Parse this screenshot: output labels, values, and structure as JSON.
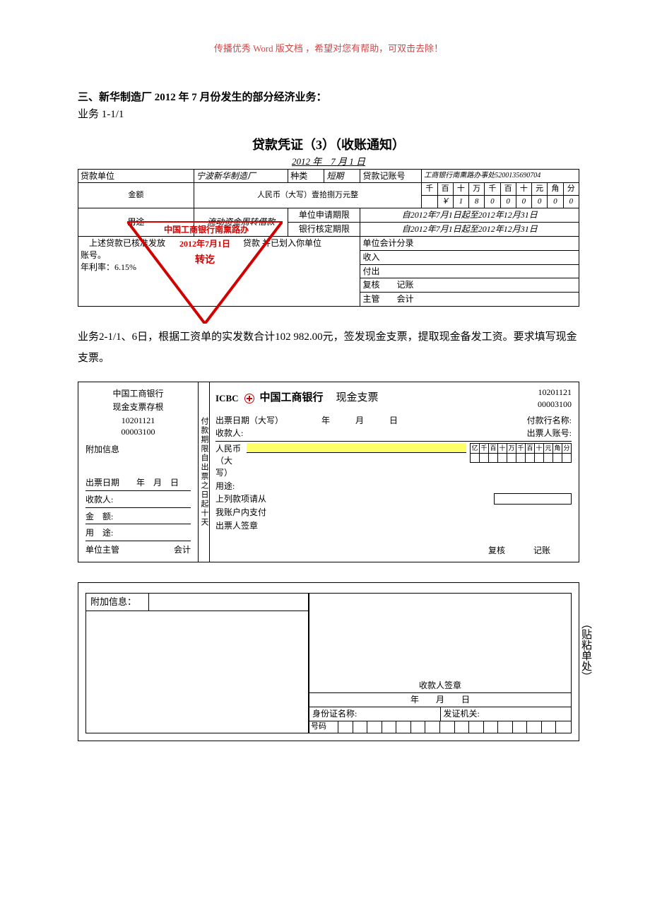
{
  "header_note": "传播优秀 Word 版文档 ，希望对您有帮助，可双击去除！",
  "section_heading": "三、新华制造厂 2012 年 7 月份发生的部分经济业务：",
  "biz_label": "业务 1-1/1",
  "voucher": {
    "title": "贷款凭证（3）（收账通知）",
    "date_line": "2012 年　7 月 1 日",
    "row1": {
      "unit_label": "贷款单位",
      "unit_value": "宁波新华制造厂",
      "type_label": "种类",
      "type_value": "短期",
      "acct_label": "贷款记账号",
      "acct_value": "工商银行南熏路办事处5200135690704"
    },
    "amount": {
      "label": "金额",
      "cn_label": "人民币（大写）壹拾捌万元整",
      "units": [
        "千",
        "百",
        "十",
        "万",
        "千",
        "百",
        "十",
        "元",
        "角",
        "分"
      ],
      "digits": [
        "",
        "￥",
        "1",
        "8",
        "0",
        "0",
        "0",
        "0",
        "0",
        "0"
      ]
    },
    "usage": {
      "label": "用途",
      "usage_text": "流动资金周转借款",
      "apply_label": "单位申请期限",
      "apply_value": "自2012年7月1日起至2012年12月31日",
      "bank_label": "银行核定期限",
      "bank_value": "自2012年7月1日起至2012年12月31日"
    },
    "bottom": {
      "l1": "　上述贷款已核准发放",
      "l2": "账号。",
      "l3": "年利率：6.15%",
      "mid": "贷款 并已划入你单位",
      "entries_label": "单位会计分录",
      "r_rows": [
        "收入",
        "付出",
        "复核　　记账",
        "主管　　会计"
      ]
    },
    "stamp": {
      "bank": "中国工商银行南熏路办",
      "date": "2012年7月1日",
      "type": "转讫"
    }
  },
  "para_biz2": "业务2-1/1、6日，根据工资单的实发数合计102 982.00元，签发现金支票，提取现金备发工资。要求填写现金支票。",
  "cheque": {
    "stub": {
      "bank": "中国工商银行",
      "title": "现金支票存根",
      "num1": "10201121",
      "num2": "00003100",
      "attach": "附加信息",
      "issue": "出票日期　　年　月　日",
      "payee": "收款人:",
      "amount": "金　额:",
      "purpose": "用　途:",
      "mgr": "单位主管",
      "acct": "会计"
    },
    "vlabel": "付款期限自出票之日起十天",
    "main": {
      "icbc": "ICBC",
      "bank_cn": "中国工商银行",
      "cheque_type": "现金支票",
      "num1": "10201121",
      "num2": "00003100",
      "issue_date": "出票日期（大写）　　　　　年　　　月　　　日",
      "payer_bank": "付款行名称:",
      "payee": "收款人:",
      "drawer_acct": "出票人账号:",
      "rmb": "人民币",
      "caps": "（大写）",
      "digit_labels": [
        "亿",
        "千",
        "百",
        "十",
        "万",
        "千",
        "百",
        "十",
        "元",
        "角",
        "分"
      ],
      "purpose": "用途:",
      "request": "上列款项请从",
      "myacct": "我账户内支付",
      "drawer_sig": "出票人签章",
      "review": "复核",
      "record": "记账"
    }
  },
  "attach": {
    "info_label": "附加信息：",
    "payee_sig": "收款人签章",
    "date": "年　　月　　日",
    "id_name": "身份证名称:",
    "issuer": "发证机关:",
    "number": "号码",
    "vside": "（贴粘单处）"
  }
}
